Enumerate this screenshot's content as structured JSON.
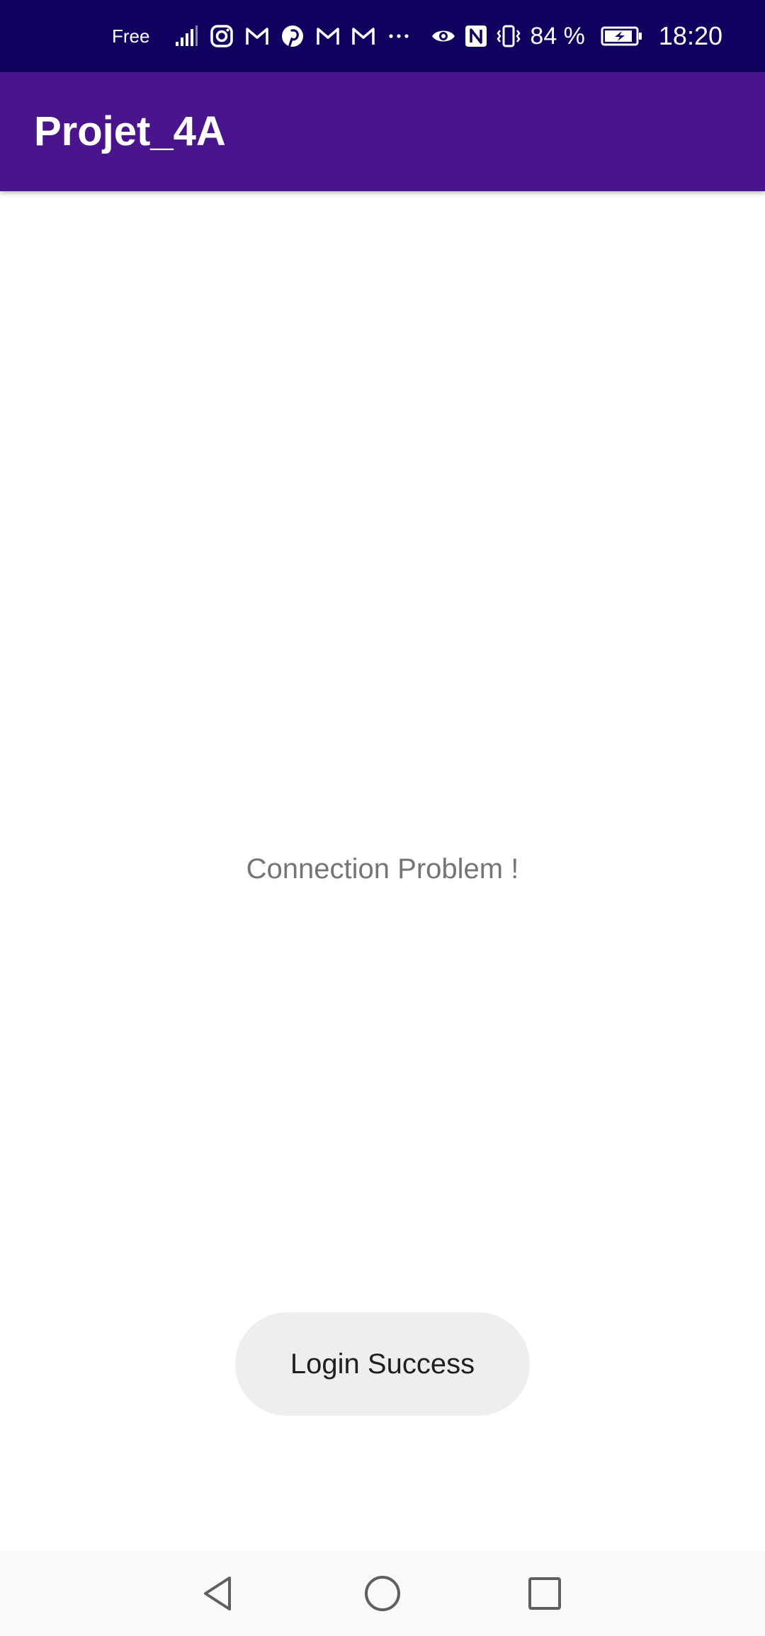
{
  "status_bar": {
    "carrier": "Free",
    "battery_percent": "84 %",
    "time": "18:20",
    "background": "#12005e",
    "icons": [
      "signal-icon",
      "instagram-icon",
      "gmail-icon",
      "pinterest-icon",
      "gmail-icon",
      "gmail-icon",
      "more-notifications-icon",
      "eye-icon",
      "nfc-icon",
      "vibrate-icon",
      "battery-charging-icon"
    ]
  },
  "app_bar": {
    "title": "Projet_4A",
    "background": "#4a148c"
  },
  "main": {
    "message": "Connection Problem !"
  },
  "toast": {
    "text": "Login Success"
  },
  "nav_bar": {
    "buttons": [
      "back-icon",
      "home-icon",
      "recents-icon"
    ]
  }
}
